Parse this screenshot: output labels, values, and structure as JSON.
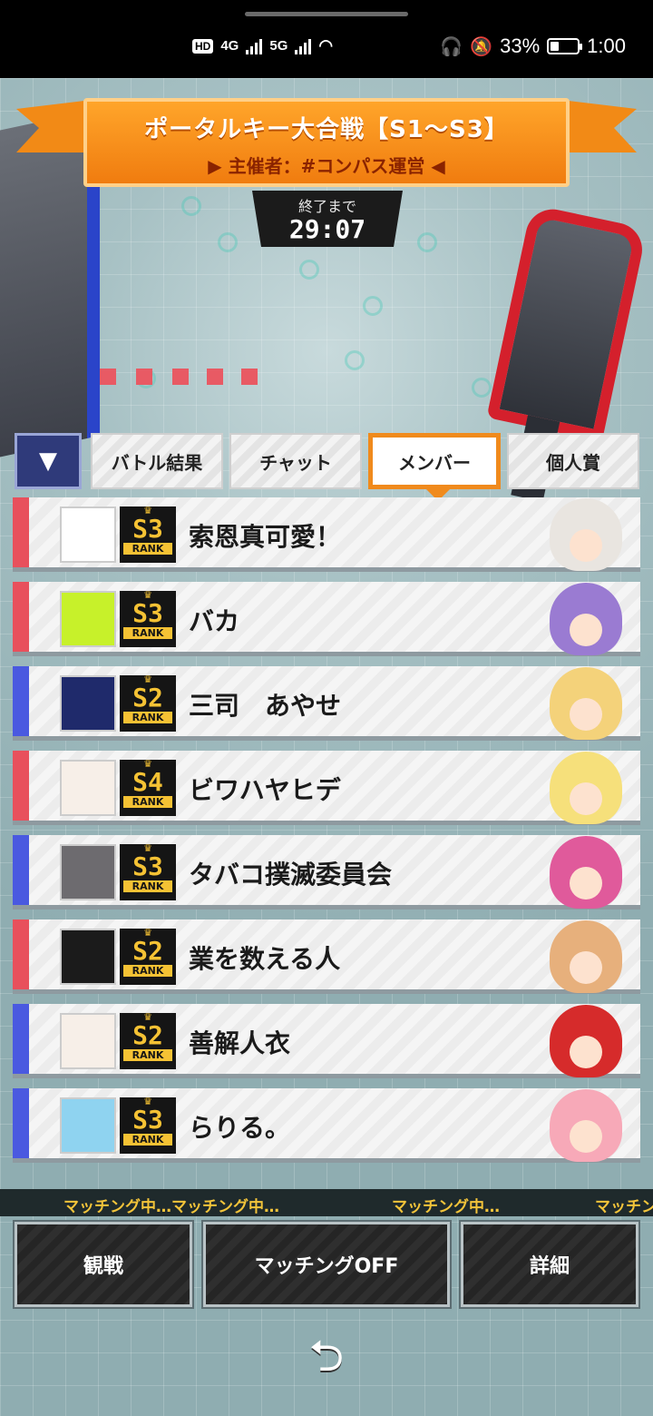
{
  "status_bar": {
    "hd": "HD",
    "sim1": "4G",
    "sim2": "5G",
    "battery": "33%",
    "battery_level": 0.33,
    "time": "1:00"
  },
  "event": {
    "title": "ポータルキー大合戦【S1〜S3】",
    "host": "▶ 主催者：#コンパス運営 ◀",
    "timer_label": "終了まで",
    "timer": "29:07"
  },
  "tabs": [
    {
      "label": "バトル結果",
      "active": false
    },
    {
      "label": "チャット",
      "active": false
    },
    {
      "label": "メンバー",
      "active": true
    },
    {
      "label": "個人賞",
      "active": false
    }
  ],
  "collapse_glyph": "▼",
  "rank_word": "RANK",
  "members": [
    {
      "name": "索恩真可愛！",
      "rank": "S3",
      "team": "red",
      "avatar_color": "#ffffff",
      "char_color": "#e9e5e0"
    },
    {
      "name": "バカ",
      "rank": "S3",
      "team": "red",
      "avatar_color": "#c7f12a",
      "char_color": "#9a7bd2"
    },
    {
      "name": "三司　あやせ",
      "rank": "S2",
      "team": "blue",
      "avatar_color": "#1f2a6b",
      "char_color": "#f4d27a"
    },
    {
      "name": "ビワハヤヒデ",
      "rank": "S4",
      "team": "red",
      "avatar_color": "#f7efe8",
      "char_color": "#f6e07b"
    },
    {
      "name": "タバコ撲滅委員会",
      "rank": "S3",
      "team": "blue",
      "avatar_color": "#6d6b6f",
      "char_color": "#e05a9b"
    },
    {
      "name": "業を数える人",
      "rank": "S2",
      "team": "red",
      "avatar_color": "#1b1b1b",
      "char_color": "#e7b07c"
    },
    {
      "name": "善解人衣",
      "rank": "S2",
      "team": "blue",
      "avatar_color": "#f7efe8",
      "char_color": "#d62b2b"
    },
    {
      "name": "らりる。",
      "rank": "S3",
      "team": "blue",
      "avatar_color": "#8fd3f0",
      "char_color": "#f7a9b8"
    }
  ],
  "ticker": [
    "マッチング中…マッチング中…",
    "マッチング中…",
    "マッチン"
  ],
  "buttons": {
    "spectate": "観戦",
    "matching_off": "マッチングOFF",
    "details": "詳細"
  },
  "back_glyph": "⮌"
}
